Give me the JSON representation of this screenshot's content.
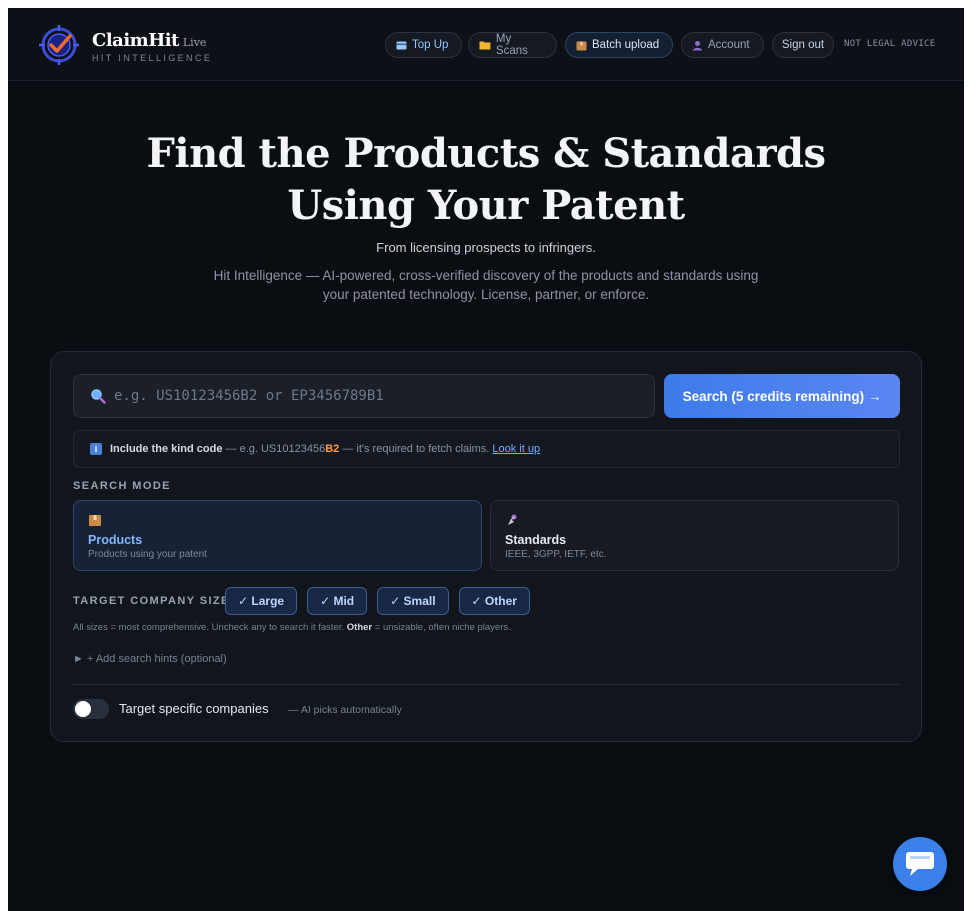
{
  "brand": {
    "name": "ClaimHit",
    "live": "Live",
    "subtitle": "HIT INTELLIGENCE"
  },
  "nav": {
    "topup": "Top Up",
    "scans": "My Scans",
    "batch": "Batch upload",
    "account": "Account",
    "signout": "Sign out",
    "legal": "NOT LEGAL ADVICE"
  },
  "hero": {
    "title_line1": "Find the Products & Standards",
    "title_line2": "Using Your Patent",
    "subtitle": "From licensing prospects to infringers.",
    "description": "Hit Intelligence — AI-powered, cross-verified discovery of the products and standards using your patented technology. License, partner, or enforce."
  },
  "search": {
    "placeholder": "e.g. US10123456B2 or EP3456789B1",
    "value": "",
    "button": "Search (5 credits remaining) →"
  },
  "hint": {
    "lead": "Include the kind code",
    "mid": " — e.g. US10123456",
    "kind": "B2",
    "tail": " — it's required to fetch claims.",
    "link": "Look it up"
  },
  "mode": {
    "label": "SEARCH MODE",
    "products": {
      "title": "Products",
      "desc": "Products using your patent"
    },
    "standards": {
      "title": "Standards",
      "desc": "IEEE, 3GPP, IETF, etc."
    }
  },
  "sizes": {
    "label": "TARGET COMPANY SIZE",
    "options": [
      "✓ Large",
      "✓ Mid",
      "✓ Small",
      "✓ Other"
    ],
    "note_pre": "All sizes = most comprehensive. Uncheck any to search it faster. ",
    "note_bold": "Other",
    "note_post": " = unsizable, often niche players."
  },
  "advanced": "► + Add search hints (optional)",
  "target": {
    "label": "Target specific companies",
    "note": "— AI picks automatically",
    "enabled": false
  },
  "colors": {
    "accent": "#3d7bea",
    "background": "#0a0d12",
    "kind_code": "#ff9a4a"
  },
  "icons": {
    "topup": "card-icon",
    "scans": "folder-icon",
    "batch": "package-icon",
    "account": "user-icon",
    "search": "magnifier-icon",
    "products": "package-icon",
    "standards": "satellite-icon",
    "chat": "chat-icon"
  }
}
